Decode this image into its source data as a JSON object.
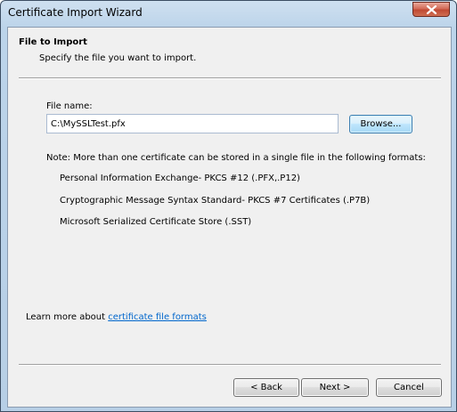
{
  "window": {
    "title": "Certificate Import Wizard",
    "close_icon": "close-icon"
  },
  "header": {
    "title": "File to Import",
    "subtitle": "Specify the file you want to import."
  },
  "file": {
    "label": "File name:",
    "value": "C:\\MySSLTest.pfx",
    "browse_label": "Browse..."
  },
  "note": {
    "text": "Note:  More than one certificate can be stored in a single file in the following formats:",
    "formats": [
      "Personal Information Exchange- PKCS #12 (.PFX,.P12)",
      "Cryptographic Message Syntax Standard- PKCS #7 Certificates (.P7B)",
      "Microsoft Serialized Certificate Store (.SST)"
    ]
  },
  "learn_more": {
    "prefix": "Learn more about ",
    "link": "certificate file formats"
  },
  "buttons": {
    "back": "< Back",
    "next": "Next >",
    "cancel": "Cancel"
  }
}
